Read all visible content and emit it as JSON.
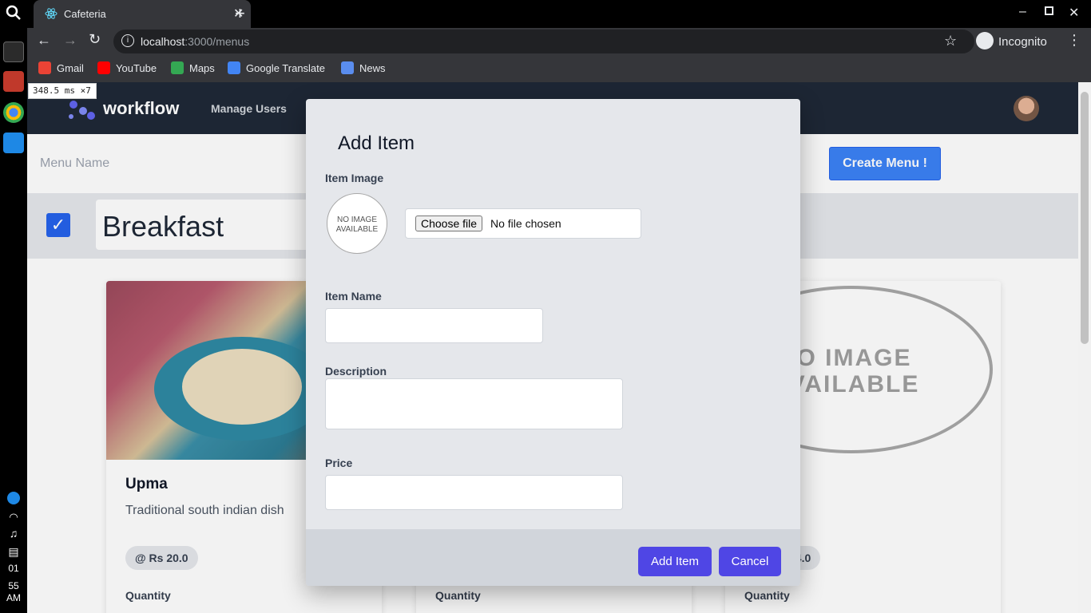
{
  "dock": {
    "tray_time": [
      "01",
      "55",
      "AM"
    ]
  },
  "devtools_badge": "348.5 ms ×7",
  "tab": {
    "title": "Cafeteria"
  },
  "address": {
    "host": "localhost",
    "path": ":3000/menus"
  },
  "profile": {
    "label": "Incognito"
  },
  "bookmarks": [
    {
      "label": "Gmail"
    },
    {
      "label": "YouTube"
    },
    {
      "label": "Maps"
    },
    {
      "label": "Google Translate"
    },
    {
      "label": "News"
    }
  ],
  "app": {
    "brand": "workflow",
    "nav_manage_users": "Manage Users",
    "menu_name_placeholder": "Menu Name",
    "create_menu_label": "Create Menu !",
    "category_title": "Breakfast"
  },
  "cards": [
    {
      "name": "Upma",
      "description": "Traditional south indian dish",
      "price": "@ Rs 20.0",
      "quantity_label": "Quantity"
    },
    {
      "quantity_label": "Quantity"
    },
    {
      "price_fragment": "24.0",
      "quantity_label": "Quantity",
      "no_image_line1": "O IMAGE",
      "no_image_line2": "VAILABLE"
    }
  ],
  "modal": {
    "title": "Add Item",
    "image_label": "Item Image",
    "no_image_line1": "NO IMAGE",
    "no_image_line2": "AVAILABLE",
    "choose_file": "Choose file",
    "no_file": "No file chosen",
    "name_label": "Item Name",
    "description_label": "Description",
    "price_label": "Price",
    "add_button": "Add Item",
    "cancel_button": "Cancel"
  },
  "colors": {
    "primary": "#4f46e5",
    "create_menu": "#3b82f6",
    "navbar": "#1f2937"
  }
}
